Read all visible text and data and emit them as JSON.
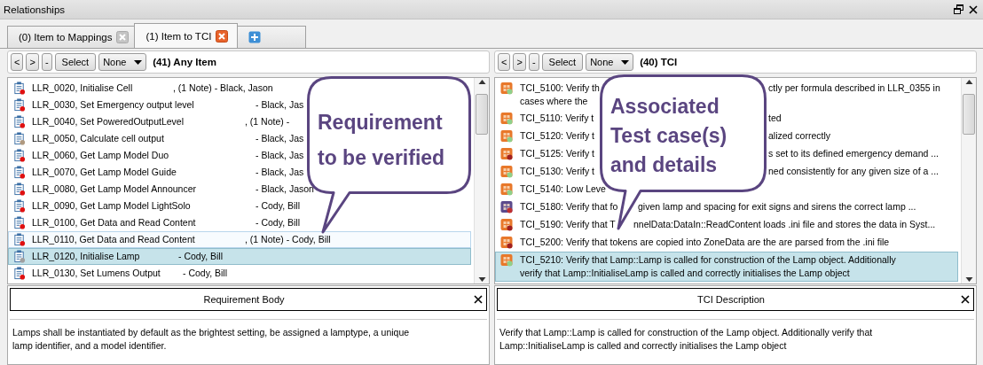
{
  "window": {
    "title": "Relationships"
  },
  "tabs": [
    {
      "label": "(0) Item to Mappings",
      "selected": false
    },
    {
      "label": "(1) Item to TCI",
      "selected": true
    }
  ],
  "panes": [
    {
      "toolbar": {
        "buttons": [
          "<",
          ">",
          "-",
          "Select"
        ],
        "filter": "None",
        "heading": "(41) Any Item"
      },
      "rows": [
        {
          "lines": [
            [
              "LLR_0020, Initialise Cell",
              ", (1 Note) - Black, Jason"
            ]
          ],
          "color": "#e01010",
          "selected": false,
          "hovered": false
        },
        {
          "lines": [
            [
              "LLR_0030, Set Emergency output level",
              "- Black, Jas"
            ]
          ],
          "color": "#e01010",
          "selected": false,
          "hovered": false
        },
        {
          "lines": [
            [
              "LLR_0040, Set PoweredOutputLevel",
              ", (1 Note) -"
            ]
          ],
          "color": "#e01010",
          "selected": false,
          "hovered": false
        },
        {
          "lines": [
            [
              "LLR_0050, Calculate cell output",
              "- Black, Jas"
            ]
          ],
          "color": "#b09a80",
          "selected": false,
          "hovered": false
        },
        {
          "lines": [
            [
              "LLR_0060, Get Lamp Model Duo",
              "- Black, Jas"
            ]
          ],
          "color": "#e01010",
          "selected": false,
          "hovered": false
        },
        {
          "lines": [
            [
              "LLR_0070, Get Lamp Model Guide",
              "- Black, Jas"
            ]
          ],
          "color": "#e01010",
          "selected": false,
          "hovered": false
        },
        {
          "lines": [
            [
              "LLR_0080, Get Lamp Model Announcer",
              "- Black, Jason"
            ]
          ],
          "color": "#e01010",
          "selected": false,
          "hovered": false
        },
        {
          "lines": [
            [
              "LLR_0090, Get Lamp Model LightSolo",
              "- Cody, Bill"
            ]
          ],
          "color": "#e01010",
          "selected": false,
          "hovered": false
        },
        {
          "lines": [
            [
              "LLR_0100, Get Data and Read Content",
              "- Cody, Bill"
            ]
          ],
          "color": "#e01010",
          "selected": false,
          "hovered": false
        },
        {
          "lines": [
            [
              "LLR_0110, Get Data and Read Content",
              ", (1 Note) - Cody, Bill"
            ]
          ],
          "color": "#e01010",
          "selected": false,
          "hovered": true
        },
        {
          "lines": [
            [
              "LLR_0120, Initialise Lamp",
              "- Cody, Bill"
            ]
          ],
          "color": "#a0a0a0",
          "selected": true,
          "hovered": false
        },
        {
          "lines": [
            [
              "LLR_0130, Set Lumens Output",
              "- Cody, Bill"
            ]
          ],
          "color": "#e01010",
          "selected": false,
          "hovered": false
        }
      ],
      "detail": {
        "title": "Requirement Body",
        "body": "Lamps shall be instantiated by default as the brightest setting, be assigned a lamptype, a unique lamp identifier, and a model identifier."
      }
    },
    {
      "toolbar": {
        "buttons": [
          "<",
          ">",
          "-",
          "Select"
        ],
        "filter": "None",
        "heading": "(40) TCI"
      },
      "rows": [
        {
          "kind": "test",
          "color": "#8fd08a",
          "selected": false,
          "hovered": false,
          "lines": [
            [
              "TCI_5100: Verify th",
              "ctly per formula described in LLR_0355 in"
            ],
            [
              "cases where the"
            ]
          ]
        },
        {
          "kind": "test",
          "color": "#8fd08a",
          "selected": false,
          "hovered": false,
          "lines": [
            [
              "TCI_5110: Verify t",
              "ted"
            ]
          ]
        },
        {
          "kind": "test",
          "color": "#8fd08a",
          "selected": false,
          "hovered": false,
          "lines": [
            [
              "TCI_5120: Verify t",
              "alized correctly"
            ]
          ]
        },
        {
          "kind": "test",
          "color": "#a02020",
          "selected": false,
          "hovered": false,
          "lines": [
            [
              "TCI_5125: Verify t",
              "s set to its defined emergency demand ..."
            ]
          ]
        },
        {
          "kind": "test",
          "color": "#8fd08a",
          "selected": false,
          "hovered": false,
          "lines": [
            [
              "TCI_5130: Verify t",
              "ned consistently  for any given size of a ..."
            ]
          ]
        },
        {
          "kind": "test",
          "color": "#8fd08a",
          "selected": false,
          "hovered": false,
          "lines": [
            [
              "TCI_5140: Low Leve"
            ]
          ]
        },
        {
          "kind": "suite",
          "color": "#c03030",
          "selected": false,
          "hovered": false,
          "lines": [
            [
              "TCI_5180: Verify that fo",
              "given lamp and spacing for exit signs and sirens the correct lamp ..."
            ]
          ]
        },
        {
          "kind": "test",
          "color": "#a02020",
          "selected": false,
          "hovered": false,
          "lines": [
            [
              "TCI_5190: Verify that T",
              "nnelData:DataIn::ReadContent loads .ini file and stores the data in Syst..."
            ]
          ]
        },
        {
          "kind": "test",
          "color": "#a02020",
          "selected": false,
          "hovered": false,
          "lines": [
            [
              "TCI_5200: Verify that tokens are copied into ZoneData are the are parsed from the .ini file"
            ]
          ]
        },
        {
          "kind": "test",
          "color": "#8fd08a",
          "selected": true,
          "hovered": false,
          "lines": [
            [
              "TCI_5210: Verify that Lamp::Lamp is called for construction of the Lamp object.  Additionally"
            ],
            [
              "verify that Lamp::InitialiseLamp is called and correctly initialises the Lamp object"
            ]
          ]
        }
      ],
      "detail": {
        "title": "TCI Description",
        "body": "Verify that Lamp::Lamp is called for construction of the Lamp object.  Additionally verify that Lamp::InitialiseLamp is called and correctly initialises the Lamp object"
      }
    }
  ],
  "callouts": [
    {
      "lines": [
        "Requirement",
        "to be verified"
      ]
    },
    {
      "lines": [
        "Associated",
        "Test case(s)",
        "and details"
      ]
    }
  ]
}
